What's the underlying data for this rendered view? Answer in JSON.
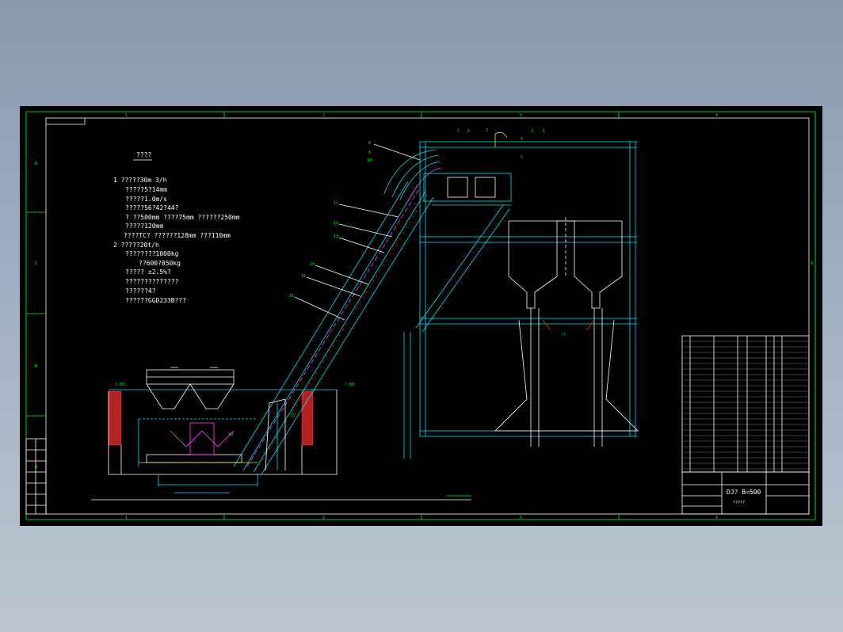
{
  "drawing": {
    "notes_title": "????",
    "notes": [
      "1  ?????30m  3/h",
      "?????5?14mm",
      "?????1.0m/s",
      "?????56?42?44?",
      "?     ??500mm ????75mm ??????250mm",
      "?????120mm",
      "????TC? ??????128mm  ???110mm",
      "2  ?????20t/h",
      "????????1000kg",
      "??600?850kg",
      "?????  ±2.5%?",
      "??????????????",
      "??????4?",
      "??????GGD233B???"
    ],
    "title_block": {
      "drawing_no": "DJ? B=500",
      "subtitle": "?????"
    },
    "grid_cols": [
      "1",
      "2",
      "3",
      "4"
    ],
    "grid_rows": [
      "D",
      "C",
      "B",
      "A"
    ],
    "callouts": [
      "1",
      "2",
      "3",
      "4",
      "5",
      "6",
      "7",
      "8",
      "9",
      "10",
      "11",
      "12",
      "13",
      "14",
      "15",
      "16",
      "17",
      "18"
    ],
    "colors": {
      "frame": "#00ff00",
      "structure": "#00e5ff",
      "text": "#ffffff",
      "magenta": "#ff44ff",
      "red": "#ff2a2a",
      "yellow": "#ffee00"
    }
  }
}
